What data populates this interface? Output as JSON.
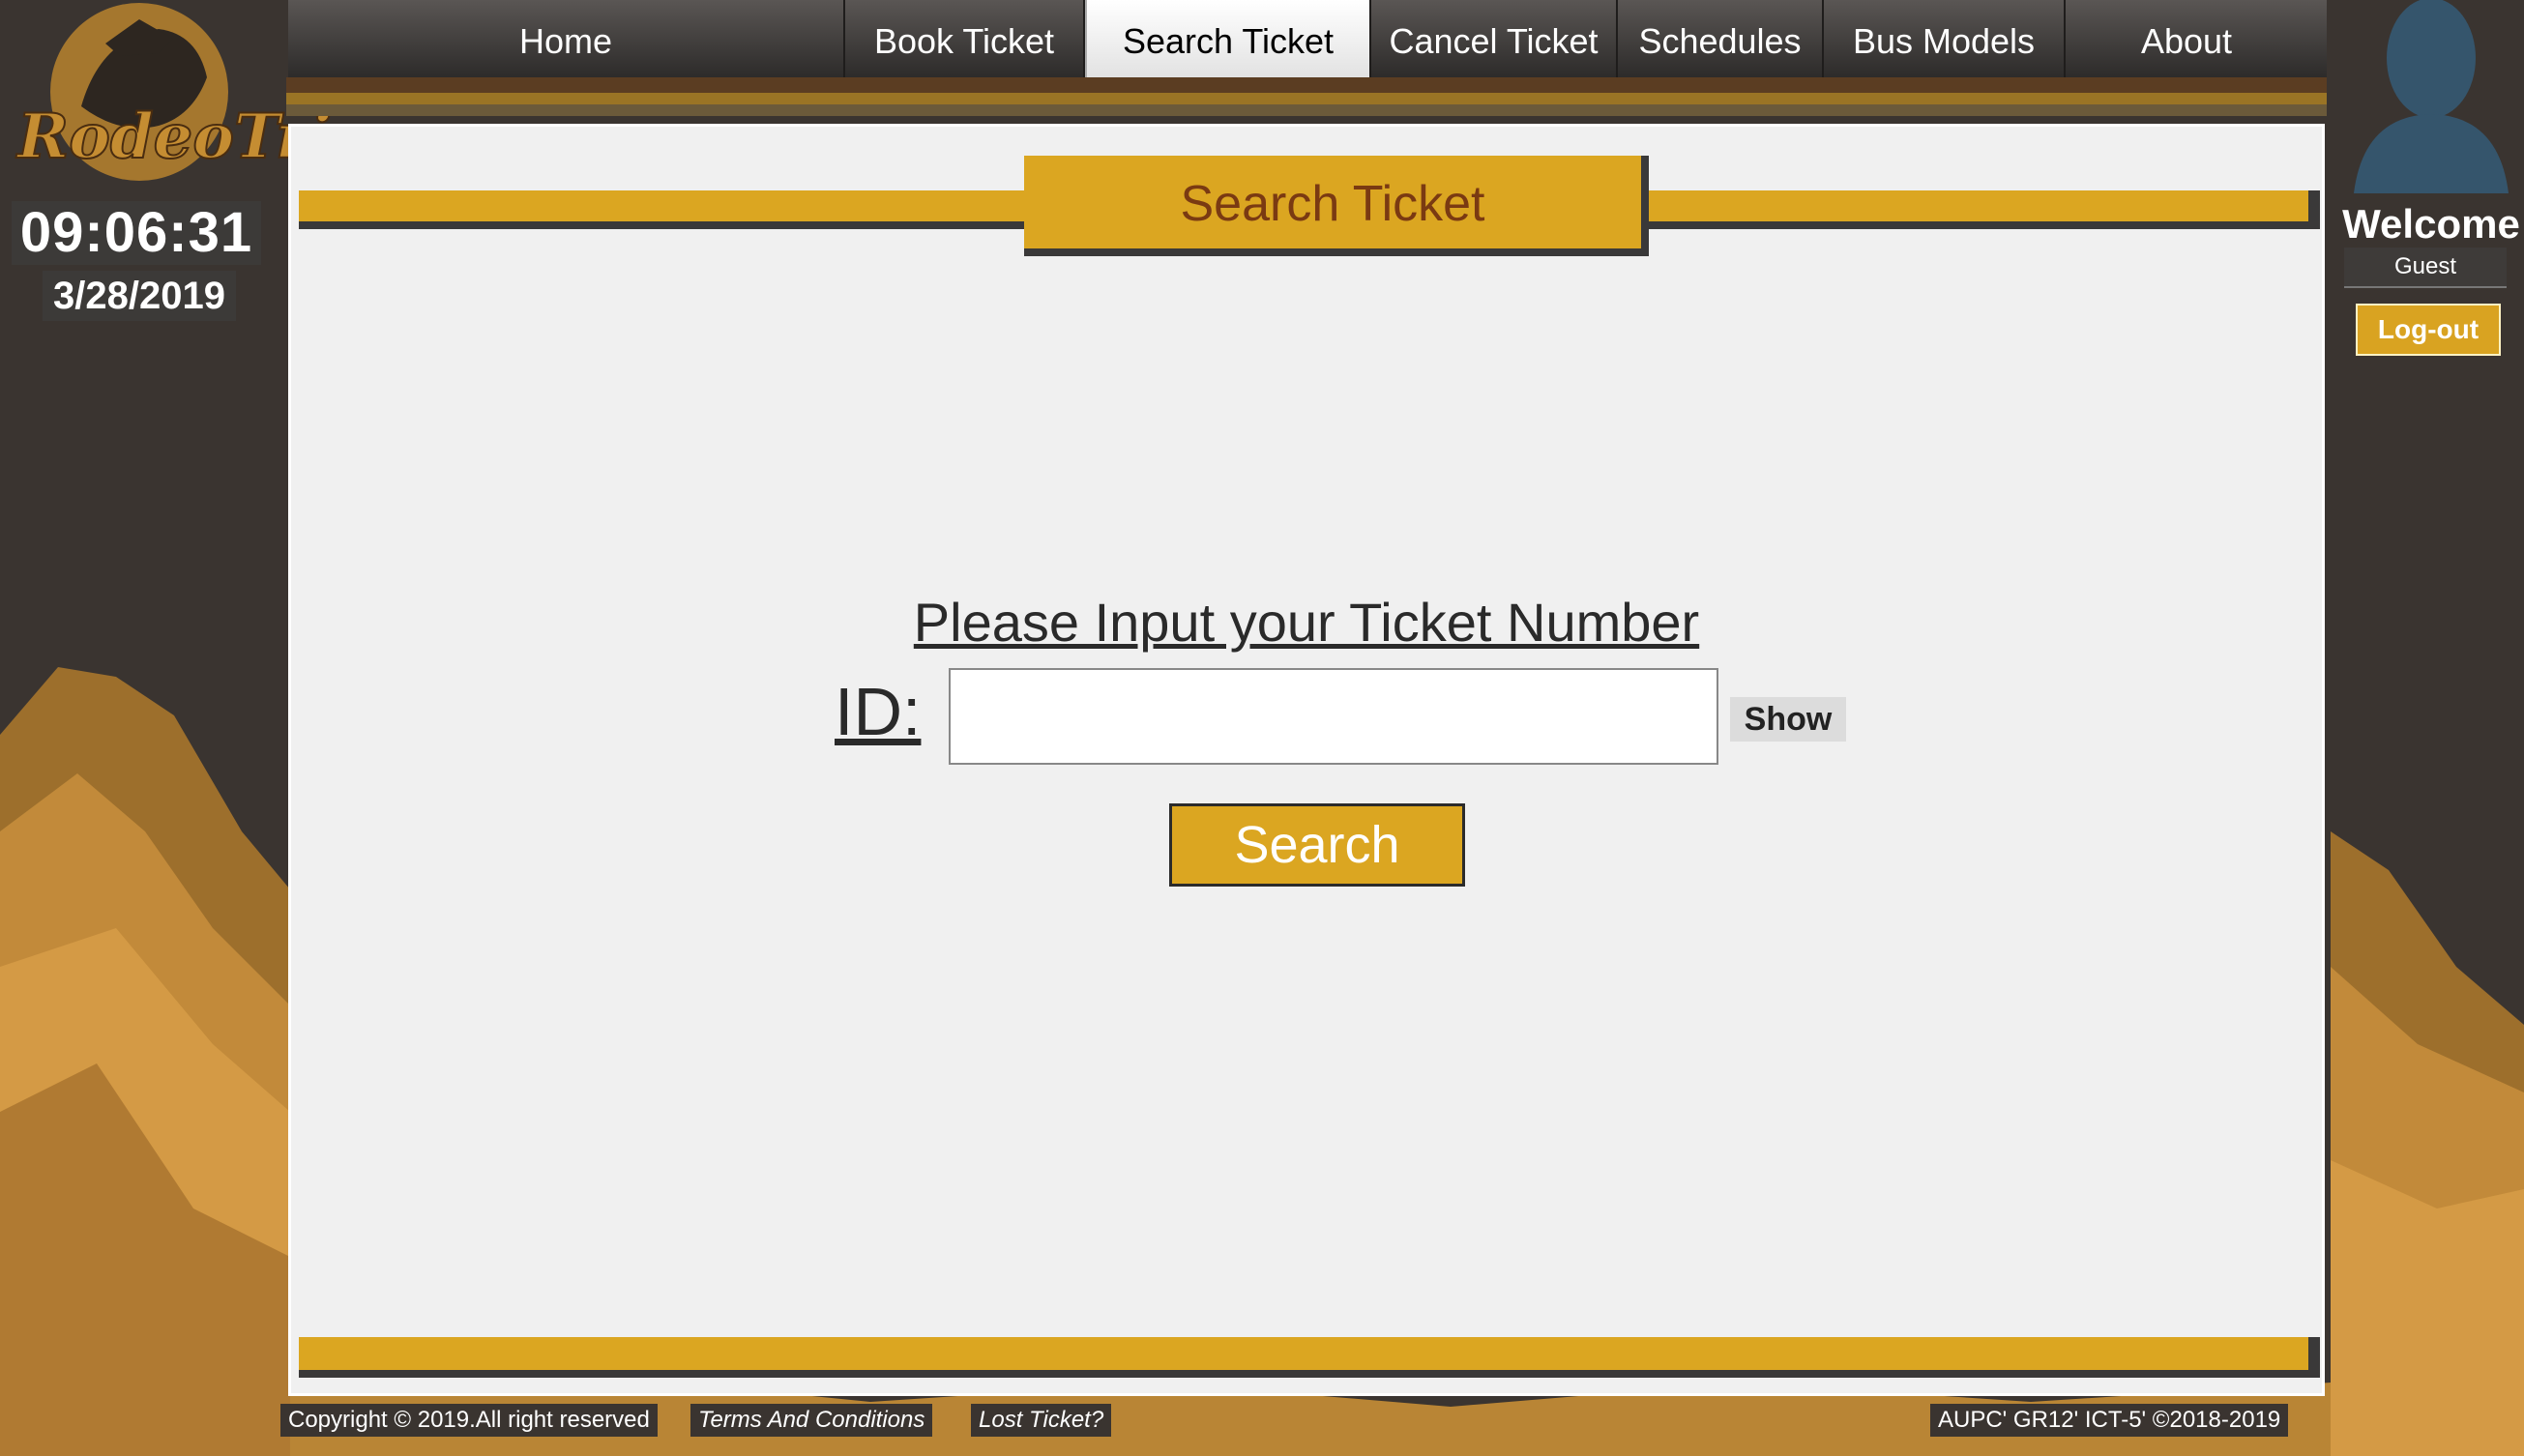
{
  "logo": {
    "text": "RodeoTrip"
  },
  "clock": {
    "time": "09:06:31",
    "date": "3/28/2019"
  },
  "nav": {
    "items": [
      {
        "label": "Home"
      },
      {
        "label": "Book Ticket"
      },
      {
        "label": "Search Ticket"
      },
      {
        "label": "Cancel Ticket"
      },
      {
        "label": "Schedules"
      },
      {
        "label": "Bus Models"
      },
      {
        "label": "About"
      }
    ],
    "active": "Search Ticket"
  },
  "user": {
    "welcome": "Welcome",
    "name": "Guest",
    "logout_label": "Log-out"
  },
  "main": {
    "title": "Search Ticket",
    "prompt": "Please Input your Ticket Number",
    "id_label": "ID:",
    "id_value": "",
    "show_label": "Show",
    "search_label": "Search"
  },
  "footer": {
    "copyright": "Copyright © 2019.All right reserved",
    "terms": "Terms And Conditions",
    "lost": "Lost Ticket?",
    "credit": "AUPC' GR12' ICT-5' ©2018-2019"
  },
  "colors": {
    "accent": "#dba621",
    "dark": "#3a3430",
    "title_text": "#7a3a12"
  }
}
